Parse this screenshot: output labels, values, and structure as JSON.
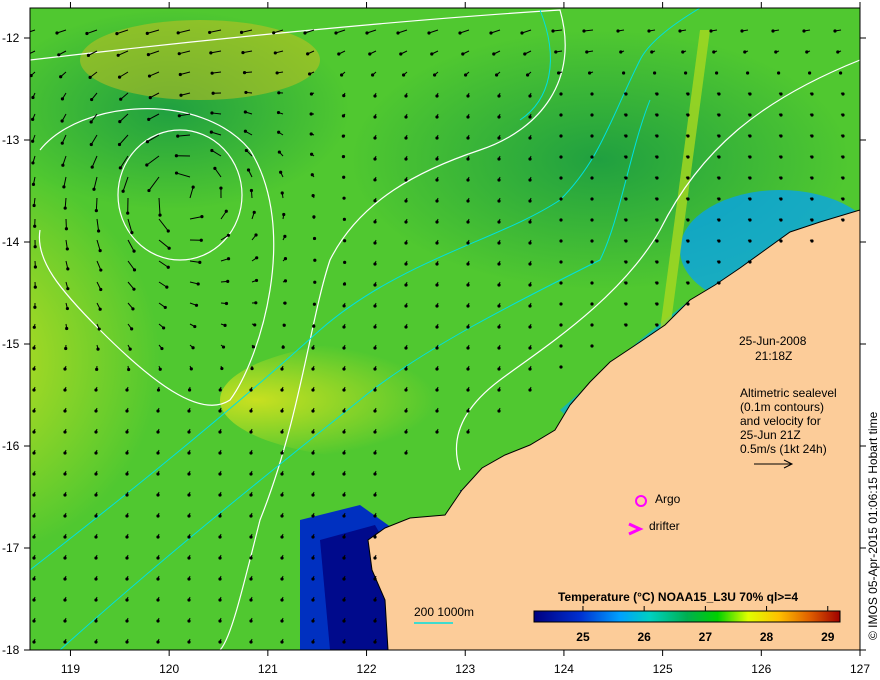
{
  "map": {
    "x_ticks": [
      "119",
      "120",
      "121",
      "122",
      "123",
      "124",
      "125",
      "126",
      "127"
    ],
    "y_ticks": [
      "-12",
      "-13",
      "-14",
      "-15",
      "-16",
      "-17",
      "-18"
    ],
    "colors": {
      "land": "#fccc99",
      "ocean_warm": "#7fd020",
      "ocean_mid": "#2fc02f",
      "ocean_cold": "#000a8c",
      "contour": "#ffffff",
      "isobath": "#00e0e0",
      "marker": "#ff00ff"
    }
  },
  "annotation": {
    "date": "25-Jun-2008",
    "time": "21:18Z",
    "lines": [
      "Altimetric sealevel",
      "(0.1m contours)",
      "and velocity for",
      "25-Jun 21Z",
      "0.5m/s (1kt 24h)"
    ]
  },
  "legend": {
    "argo": "Argo",
    "drifter": "drifter"
  },
  "isobath_label": "200  1000m",
  "colorbar": {
    "title": "Temperature (°C) NOAA15_L3U 70% ql>=4",
    "ticks": [
      "25",
      "26",
      "27",
      "28",
      "29"
    ],
    "min": 24.2,
    "max": 29.2
  },
  "credit": "© IMOS 05-Apr-2015 01:06:15 Hobart time"
}
